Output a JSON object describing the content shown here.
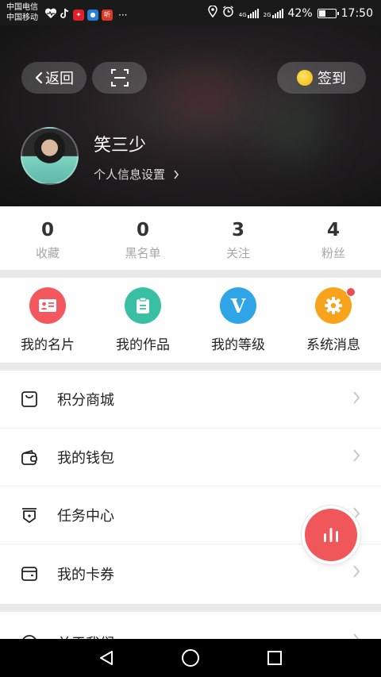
{
  "status_bar": {
    "carrier_1": "中国电信",
    "carrier_2": "中国移动",
    "more": "···",
    "signal_1": "4G",
    "signal_2": "2G",
    "battery_percent_text": "42%",
    "battery_level": 0.42,
    "time": "17:50"
  },
  "header": {
    "back_label": "返回",
    "checkin_label": "签到",
    "username": "笑三少",
    "profile_settings_label": "个人信息设置"
  },
  "stats": [
    {
      "value": "0",
      "label": "收藏"
    },
    {
      "value": "0",
      "label": "黑名单"
    },
    {
      "value": "3",
      "label": "关注"
    },
    {
      "value": "4",
      "label": "粉丝"
    }
  ],
  "actions": [
    {
      "label": "我的名片",
      "icon": "business-card-icon",
      "color": "#f2585d"
    },
    {
      "label": "我的作品",
      "icon": "clipboard-icon",
      "color": "#39c0a4"
    },
    {
      "label": "我的等级",
      "icon": "v-level-icon",
      "color": "#2fa4e7",
      "glyph": "V"
    },
    {
      "label": "系统消息",
      "icon": "gear-icon",
      "color": "#f9a21b",
      "has_badge": true
    }
  ],
  "menu": [
    {
      "label": "积分商城",
      "icon": "shopping-bag-icon"
    },
    {
      "label": "我的钱包",
      "icon": "wallet-icon"
    },
    {
      "label": "任务中心",
      "icon": "task-icon"
    },
    {
      "label": "我的卡券",
      "icon": "card-coupon-icon"
    },
    {
      "label": "关于我们",
      "icon": "info-icon"
    }
  ],
  "colors": {
    "accent_red": "#f0575b",
    "separator": "#e9e9e9"
  }
}
